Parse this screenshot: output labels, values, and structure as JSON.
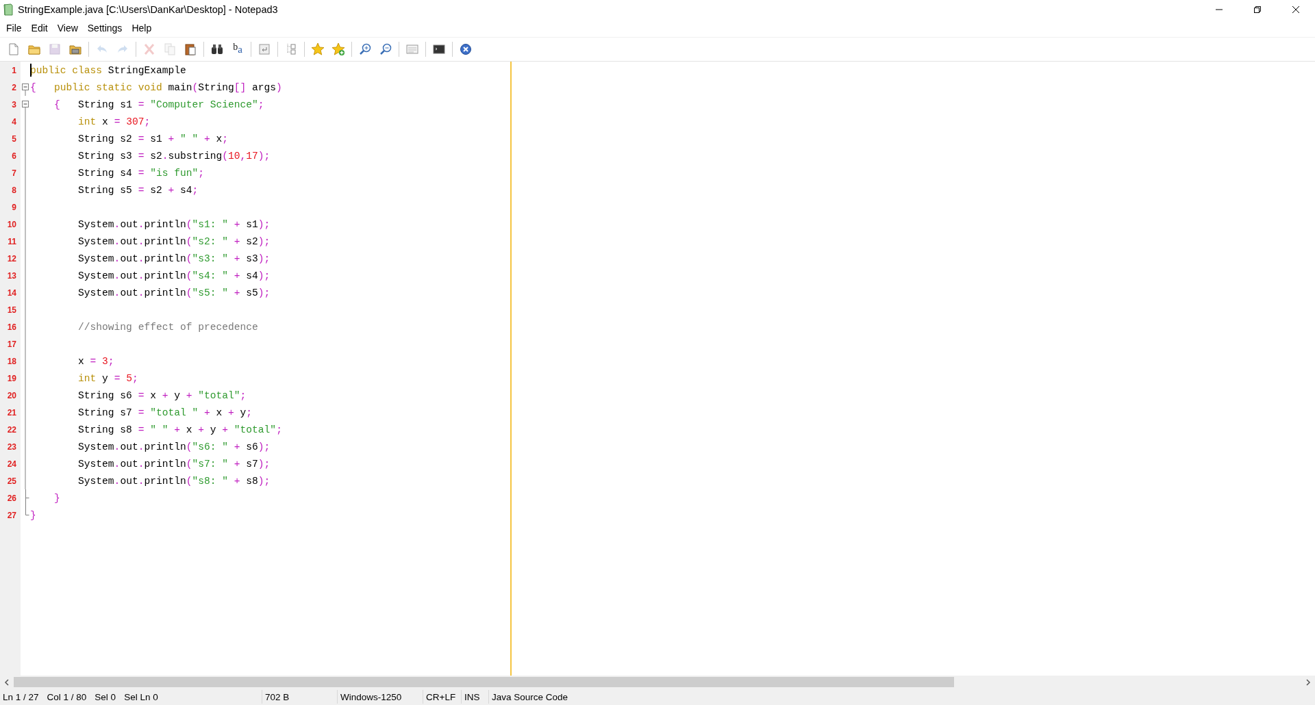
{
  "window": {
    "title": "StringExample.java [C:\\Users\\DanKar\\Desktop] - Notepad3"
  },
  "menu": [
    "File",
    "Edit",
    "View",
    "Settings",
    "Help"
  ],
  "toolbar": [
    {
      "kind": "new",
      "disabled": false
    },
    {
      "kind": "open",
      "disabled": false
    },
    {
      "kind": "save",
      "disabled": true
    },
    {
      "kind": "save-as",
      "disabled": false
    },
    {
      "kind": "separator"
    },
    {
      "kind": "undo",
      "disabled": true
    },
    {
      "kind": "redo",
      "disabled": true
    },
    {
      "kind": "separator"
    },
    {
      "kind": "cut",
      "disabled": true
    },
    {
      "kind": "copy",
      "disabled": true
    },
    {
      "kind": "paste",
      "disabled": false
    },
    {
      "kind": "separator"
    },
    {
      "kind": "find",
      "disabled": false
    },
    {
      "kind": "replace",
      "disabled": false,
      "glyph_top": "b",
      "glyph_bottom": "a"
    },
    {
      "kind": "separator"
    },
    {
      "kind": "wrap",
      "disabled": false
    },
    {
      "kind": "separator"
    },
    {
      "kind": "tree",
      "disabled": false
    },
    {
      "kind": "separator"
    },
    {
      "kind": "star",
      "disabled": false
    },
    {
      "kind": "star-add",
      "disabled": false
    },
    {
      "kind": "separator"
    },
    {
      "kind": "zoom-in",
      "disabled": false
    },
    {
      "kind": "zoom-out",
      "disabled": false
    },
    {
      "kind": "separator"
    },
    {
      "kind": "window",
      "disabled": false
    },
    {
      "kind": "separator"
    },
    {
      "kind": "terminal",
      "disabled": false
    },
    {
      "kind": "separator"
    },
    {
      "kind": "exit",
      "disabled": false
    }
  ],
  "editor": {
    "lines": [
      {
        "number": "1",
        "kind": "plain",
        "caret": true,
        "tokens": [
          {
            "kind": "keyword",
            "text": "public class"
          },
          {
            "kind": "plain",
            "text": " StringExample"
          }
        ]
      },
      {
        "number": "2",
        "kind": "fold-start",
        "caret": false,
        "tokens": [
          {
            "kind": "op",
            "text": "{"
          },
          {
            "kind": "keyword",
            "text": "   public static void"
          },
          {
            "kind": "plain",
            "text": " main"
          },
          {
            "kind": "op",
            "text": "("
          },
          {
            "kind": "plain",
            "text": "String"
          },
          {
            "kind": "op",
            "text": "[]"
          },
          {
            "kind": "plain",
            "text": " args"
          },
          {
            "kind": "op",
            "text": ")"
          }
        ]
      },
      {
        "number": "3",
        "kind": "fold-start",
        "caret": false,
        "tokens": [
          {
            "kind": "op",
            "text": "    {"
          },
          {
            "kind": "plain",
            "text": "   String s1 "
          },
          {
            "kind": "op",
            "text": "="
          },
          {
            "kind": "string",
            "text": " \"Computer Science\""
          },
          {
            "kind": "op",
            "text": ";"
          }
        ]
      },
      {
        "number": "4",
        "kind": "fold-body",
        "caret": false,
        "tokens": [
          {
            "kind": "keyword",
            "text": "        int"
          },
          {
            "kind": "plain",
            "text": " x "
          },
          {
            "kind": "op",
            "text": "="
          },
          {
            "kind": "number",
            "text": " 307"
          },
          {
            "kind": "op",
            "text": ";"
          }
        ]
      },
      {
        "number": "5",
        "kind": "fold-body",
        "caret": false,
        "tokens": [
          {
            "kind": "plain",
            "text": "        String s2 "
          },
          {
            "kind": "op",
            "text": "="
          },
          {
            "kind": "plain",
            "text": " s1 "
          },
          {
            "kind": "op",
            "text": "+"
          },
          {
            "kind": "string",
            "text": " \" \" "
          },
          {
            "kind": "op",
            "text": "+"
          },
          {
            "kind": "plain",
            "text": " x"
          },
          {
            "kind": "op",
            "text": ";"
          }
        ]
      },
      {
        "number": "6",
        "kind": "fold-body",
        "caret": false,
        "tokens": [
          {
            "kind": "plain",
            "text": "        String s3 "
          },
          {
            "kind": "op",
            "text": "="
          },
          {
            "kind": "plain",
            "text": " s2"
          },
          {
            "kind": "op",
            "text": "."
          },
          {
            "kind": "plain",
            "text": "substring"
          },
          {
            "kind": "op",
            "text": "("
          },
          {
            "kind": "number",
            "text": "10"
          },
          {
            "kind": "op",
            "text": ","
          },
          {
            "kind": "number",
            "text": "17"
          },
          {
            "kind": "op",
            "text": ");"
          }
        ]
      },
      {
        "number": "7",
        "kind": "fold-body",
        "caret": false,
        "tokens": [
          {
            "kind": "plain",
            "text": "        String s4 "
          },
          {
            "kind": "op",
            "text": "="
          },
          {
            "kind": "string",
            "text": " \"is fun\""
          },
          {
            "kind": "op",
            "text": ";"
          }
        ]
      },
      {
        "number": "8",
        "kind": "fold-body",
        "caret": false,
        "tokens": [
          {
            "kind": "plain",
            "text": "        String s5 "
          },
          {
            "kind": "op",
            "text": "="
          },
          {
            "kind": "plain",
            "text": " s2 "
          },
          {
            "kind": "op",
            "text": "+"
          },
          {
            "kind": "plain",
            "text": " s4"
          },
          {
            "kind": "op",
            "text": ";"
          }
        ]
      },
      {
        "number": "9",
        "kind": "fold-body",
        "caret": false
      },
      {
        "number": "10",
        "kind": "fold-body",
        "caret": false,
        "tokens": [
          {
            "kind": "plain",
            "text": "        System"
          },
          {
            "kind": "op",
            "text": "."
          },
          {
            "kind": "plain",
            "text": "out"
          },
          {
            "kind": "op",
            "text": "."
          },
          {
            "kind": "plain",
            "text": "println"
          },
          {
            "kind": "op",
            "text": "("
          },
          {
            "kind": "string",
            "text": "\"s1: \" "
          },
          {
            "kind": "op",
            "text": "+"
          },
          {
            "kind": "plain",
            "text": " s1"
          },
          {
            "kind": "op",
            "text": ");"
          }
        ]
      },
      {
        "number": "11",
        "kind": "fold-body",
        "caret": false,
        "tokens": [
          {
            "kind": "plain",
            "text": "        System"
          },
          {
            "kind": "op",
            "text": "."
          },
          {
            "kind": "plain",
            "text": "out"
          },
          {
            "kind": "op",
            "text": "."
          },
          {
            "kind": "plain",
            "text": "println"
          },
          {
            "kind": "op",
            "text": "("
          },
          {
            "kind": "string",
            "text": "\"s2: \" "
          },
          {
            "kind": "op",
            "text": "+"
          },
          {
            "kind": "plain",
            "text": " s2"
          },
          {
            "kind": "op",
            "text": ");"
          }
        ]
      },
      {
        "number": "12",
        "kind": "fold-body",
        "caret": false,
        "tokens": [
          {
            "kind": "plain",
            "text": "        System"
          },
          {
            "kind": "op",
            "text": "."
          },
          {
            "kind": "plain",
            "text": "out"
          },
          {
            "kind": "op",
            "text": "."
          },
          {
            "kind": "plain",
            "text": "println"
          },
          {
            "kind": "op",
            "text": "("
          },
          {
            "kind": "string",
            "text": "\"s3: \" "
          },
          {
            "kind": "op",
            "text": "+"
          },
          {
            "kind": "plain",
            "text": " s3"
          },
          {
            "kind": "op",
            "text": ");"
          }
        ]
      },
      {
        "number": "13",
        "kind": "fold-body",
        "caret": false,
        "tokens": [
          {
            "kind": "plain",
            "text": "        System"
          },
          {
            "kind": "op",
            "text": "."
          },
          {
            "kind": "plain",
            "text": "out"
          },
          {
            "kind": "op",
            "text": "."
          },
          {
            "kind": "plain",
            "text": "println"
          },
          {
            "kind": "op",
            "text": "("
          },
          {
            "kind": "string",
            "text": "\"s4: \" "
          },
          {
            "kind": "op",
            "text": "+"
          },
          {
            "kind": "plain",
            "text": " s4"
          },
          {
            "kind": "op",
            "text": ");"
          }
        ]
      },
      {
        "number": "14",
        "kind": "fold-body",
        "caret": false,
        "tokens": [
          {
            "kind": "plain",
            "text": "        System"
          },
          {
            "kind": "op",
            "text": "."
          },
          {
            "kind": "plain",
            "text": "out"
          },
          {
            "kind": "op",
            "text": "."
          },
          {
            "kind": "plain",
            "text": "println"
          },
          {
            "kind": "op",
            "text": "("
          },
          {
            "kind": "string",
            "text": "\"s5: \" "
          },
          {
            "kind": "op",
            "text": "+"
          },
          {
            "kind": "plain",
            "text": " s5"
          },
          {
            "kind": "op",
            "text": ");"
          }
        ]
      },
      {
        "number": "15",
        "kind": "fold-body",
        "caret": false
      },
      {
        "number": "16",
        "kind": "fold-body",
        "caret": false,
        "tokens": [
          {
            "kind": "comment",
            "text": "        //showing effect of precedence"
          }
        ]
      },
      {
        "number": "17",
        "kind": "fold-body",
        "caret": false
      },
      {
        "number": "18",
        "kind": "fold-body",
        "caret": false,
        "tokens": [
          {
            "kind": "plain",
            "text": "        x "
          },
          {
            "kind": "op",
            "text": "="
          },
          {
            "kind": "number",
            "text": " 3"
          },
          {
            "kind": "op",
            "text": ";"
          }
        ]
      },
      {
        "number": "19",
        "kind": "fold-body",
        "caret": false,
        "tokens": [
          {
            "kind": "keyword",
            "text": "        int"
          },
          {
            "kind": "plain",
            "text": " y "
          },
          {
            "kind": "op",
            "text": "="
          },
          {
            "kind": "number",
            "text": " 5"
          },
          {
            "kind": "op",
            "text": ";"
          }
        ]
      },
      {
        "number": "20",
        "kind": "fold-body",
        "caret": false,
        "tokens": [
          {
            "kind": "plain",
            "text": "        String s6 "
          },
          {
            "kind": "op",
            "text": "="
          },
          {
            "kind": "plain",
            "text": " x "
          },
          {
            "kind": "op",
            "text": "+"
          },
          {
            "kind": "plain",
            "text": " y "
          },
          {
            "kind": "op",
            "text": "+"
          },
          {
            "kind": "string",
            "text": " \"total\""
          },
          {
            "kind": "op",
            "text": ";"
          }
        ]
      },
      {
        "number": "21",
        "kind": "fold-body",
        "caret": false,
        "tokens": [
          {
            "kind": "plain",
            "text": "        String s7 "
          },
          {
            "kind": "op",
            "text": "="
          },
          {
            "kind": "string",
            "text": " \"total \" "
          },
          {
            "kind": "op",
            "text": "+"
          },
          {
            "kind": "plain",
            "text": " x "
          },
          {
            "kind": "op",
            "text": "+"
          },
          {
            "kind": "plain",
            "text": " y"
          },
          {
            "kind": "op",
            "text": ";"
          }
        ]
      },
      {
        "number": "22",
        "kind": "fold-body",
        "caret": false,
        "tokens": [
          {
            "kind": "plain",
            "text": "        String s8 "
          },
          {
            "kind": "op",
            "text": "="
          },
          {
            "kind": "string",
            "text": " \" \" "
          },
          {
            "kind": "op",
            "text": "+"
          },
          {
            "kind": "plain",
            "text": " x "
          },
          {
            "kind": "op",
            "text": "+"
          },
          {
            "kind": "plain",
            "text": " y "
          },
          {
            "kind": "op",
            "text": "+"
          },
          {
            "kind": "string",
            "text": " \"total\""
          },
          {
            "kind": "op",
            "text": ";"
          }
        ]
      },
      {
        "number": "23",
        "kind": "fold-body",
        "caret": false,
        "tokens": [
          {
            "kind": "plain",
            "text": "        System"
          },
          {
            "kind": "op",
            "text": "."
          },
          {
            "kind": "plain",
            "text": "out"
          },
          {
            "kind": "op",
            "text": "."
          },
          {
            "kind": "plain",
            "text": "println"
          },
          {
            "kind": "op",
            "text": "("
          },
          {
            "kind": "string",
            "text": "\"s6: \" "
          },
          {
            "kind": "op",
            "text": "+"
          },
          {
            "kind": "plain",
            "text": " s6"
          },
          {
            "kind": "op",
            "text": ");"
          }
        ]
      },
      {
        "number": "24",
        "kind": "fold-body",
        "caret": false,
        "tokens": [
          {
            "kind": "plain",
            "text": "        System"
          },
          {
            "kind": "op",
            "text": "."
          },
          {
            "kind": "plain",
            "text": "out"
          },
          {
            "kind": "op",
            "text": "."
          },
          {
            "kind": "plain",
            "text": "println"
          },
          {
            "kind": "op",
            "text": "("
          },
          {
            "kind": "string",
            "text": "\"s7: \" "
          },
          {
            "kind": "op",
            "text": "+"
          },
          {
            "kind": "plain",
            "text": " s7"
          },
          {
            "kind": "op",
            "text": ");"
          }
        ]
      },
      {
        "number": "25",
        "kind": "fold-body",
        "caret": false,
        "tokens": [
          {
            "kind": "plain",
            "text": "        System"
          },
          {
            "kind": "op",
            "text": "."
          },
          {
            "kind": "plain",
            "text": "out"
          },
          {
            "kind": "op",
            "text": "."
          },
          {
            "kind": "plain",
            "text": "println"
          },
          {
            "kind": "op",
            "text": "("
          },
          {
            "kind": "string",
            "text": "\"s8: \" "
          },
          {
            "kind": "op",
            "text": "+"
          },
          {
            "kind": "plain",
            "text": " s8"
          },
          {
            "kind": "op",
            "text": ");"
          }
        ]
      },
      {
        "number": "26",
        "kind": "fold-tee",
        "caret": false,
        "tokens": [
          {
            "kind": "op",
            "text": "    }"
          }
        ]
      },
      {
        "number": "27",
        "kind": "fold-end",
        "caret": false,
        "tokens": [
          {
            "kind": "op",
            "text": "}"
          }
        ]
      }
    ]
  },
  "status_bar": [
    {
      "items": [
        "Ln 1 / 27",
        "Col 1 / 80",
        "Sel 0",
        "Sel Ln 0"
      ]
    },
    {
      "items": [
        "702 B"
      ]
    },
    {
      "items": [
        "Windows-1250"
      ]
    },
    {
      "items": [
        "CR+LF"
      ]
    },
    {
      "items": [
        "INS"
      ]
    },
    {
      "items": [
        "Java Source Code"
      ]
    }
  ]
}
